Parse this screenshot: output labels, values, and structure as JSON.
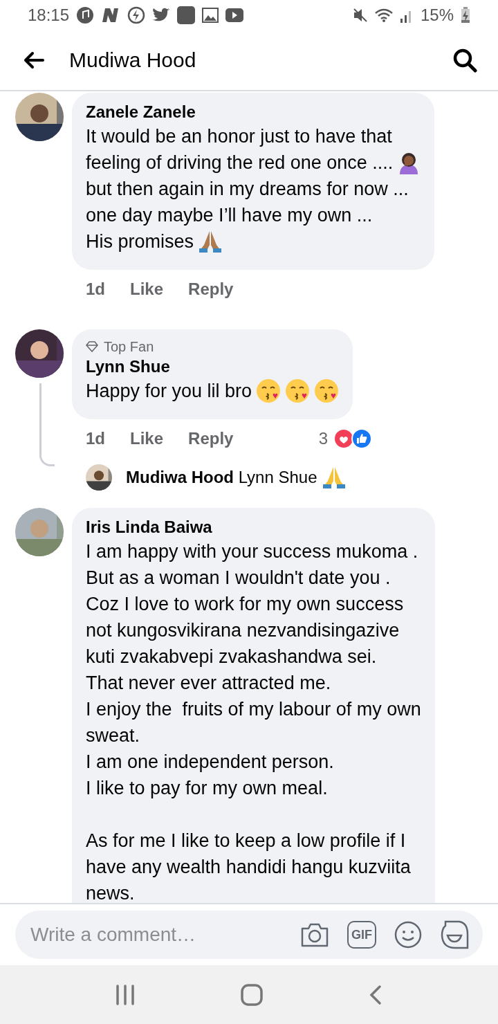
{
  "status_bar": {
    "time": "18:15",
    "battery": "15%"
  },
  "header": {
    "title": "Mudiwa Hood"
  },
  "comments": [
    {
      "author": "Zanele Zanele",
      "lines": [
        {
          "text": "It would be an honor just to have that"
        },
        {
          "text": "feeling of driving the red one once ....",
          "emoji": [
            {
              "kind": "facepalm"
            }
          ]
        },
        {
          "text": "but then again in my dreams for now ..."
        },
        {
          "text": "one day maybe I’ll have my own ..."
        },
        {
          "text": "His promises",
          "emoji": [
            {
              "kind": "pray_dark"
            }
          ]
        }
      ],
      "time": "1d",
      "like": "Like",
      "reply": "Reply"
    },
    {
      "badge": "Top Fan",
      "author": "Lynn Shue",
      "lines": [
        {
          "text": "Happy for you lil bro",
          "emoji": [
            {
              "kind": "kiss"
            },
            {
              "kind": "kiss"
            },
            {
              "kind": "kiss"
            }
          ]
        }
      ],
      "time": "1d",
      "like": "Like",
      "reply": "Reply",
      "reactions": {
        "count": "3",
        "types": [
          {
            "kind": "love"
          },
          {
            "kind": "like"
          }
        ]
      },
      "replies": [
        {
          "text": "**Mudiwa Hood** Lynn Shue",
          "emoji": [
            {
              "kind": "pray"
            }
          ]
        }
      ]
    },
    {
      "author": "Iris Linda Baiwa",
      "lines": [
        {
          "text": "I am happy with your success mukoma ."
        },
        {
          "text": "But as a woman I wouldn't date you ."
        },
        {
          "text": "Coz I love to work for my own success"
        },
        {
          "text": "not kungosvikirana nezvandisingazive"
        },
        {
          "text": "kuti zvakabvepi zvakashandwa sei."
        },
        {
          "text": "That never ever attracted me."
        },
        {
          "text": "I enjoy the  fruits of my labour of my own"
        },
        {
          "text": "sweat."
        },
        {
          "text": "I am one independent person."
        },
        {
          "text": "I like to pay for my own meal."
        },
        {
          "text": "As for me I like to keep a low profile if I",
          "gap": true
        },
        {
          "text": "have any wealth handidi hangu kuzviita"
        },
        {
          "text": "news."
        }
      ]
    }
  ],
  "composer": {
    "placeholder": "Write a comment…",
    "gif": "GIF"
  }
}
